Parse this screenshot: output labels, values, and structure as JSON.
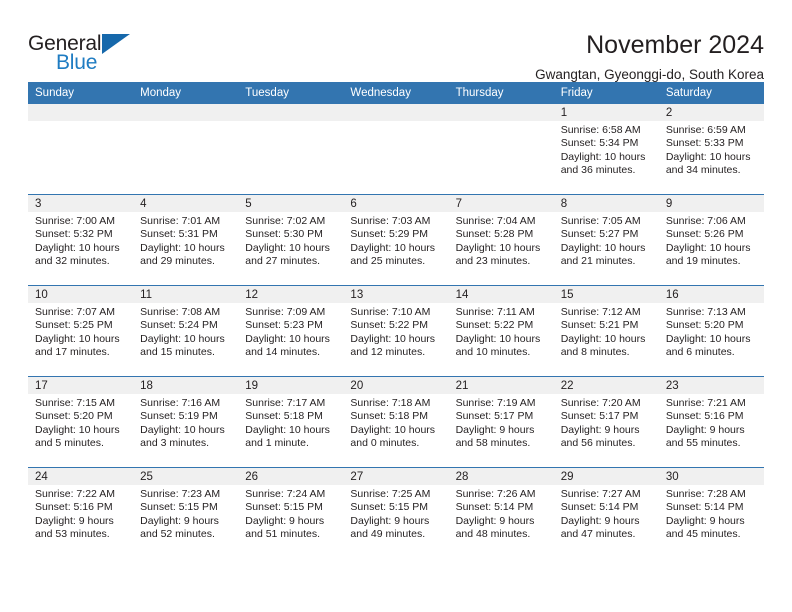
{
  "logo": {
    "word_top": "General",
    "word_bottom": "Blue",
    "triangle_color": "#1668ab",
    "blue_color": "#1f7cc2",
    "icon": "general-blue-logo"
  },
  "header": {
    "title": "November 2024",
    "location": "Gwangtan, Gyeonggi-do, South Korea"
  },
  "theme": {
    "header_blue": "#3375b0",
    "daynum_strip_gray": "#f0f0f0",
    "text": "#231f20"
  },
  "weekday_headers": [
    "Sunday",
    "Monday",
    "Tuesday",
    "Wednesday",
    "Thursday",
    "Friday",
    "Saturday"
  ],
  "weeks": [
    [
      {
        "day": "",
        "empty": true,
        "sunrise": "",
        "sunset": "",
        "daylight_line1": "",
        "daylight_line2": ""
      },
      {
        "day": "",
        "empty": true,
        "sunrise": "",
        "sunset": "",
        "daylight_line1": "",
        "daylight_line2": ""
      },
      {
        "day": "",
        "empty": true,
        "sunrise": "",
        "sunset": "",
        "daylight_line1": "",
        "daylight_line2": ""
      },
      {
        "day": "",
        "empty": true,
        "sunrise": "",
        "sunset": "",
        "daylight_line1": "",
        "daylight_line2": ""
      },
      {
        "day": "",
        "empty": true,
        "sunrise": "",
        "sunset": "",
        "daylight_line1": "",
        "daylight_line2": ""
      },
      {
        "day": "1",
        "empty": false,
        "sunrise": "Sunrise: 6:58 AM",
        "sunset": "Sunset: 5:34 PM",
        "daylight_line1": "Daylight: 10 hours",
        "daylight_line2": "and 36 minutes."
      },
      {
        "day": "2",
        "empty": false,
        "sunrise": "Sunrise: 6:59 AM",
        "sunset": "Sunset: 5:33 PM",
        "daylight_line1": "Daylight: 10 hours",
        "daylight_line2": "and 34 minutes."
      }
    ],
    [
      {
        "day": "3",
        "empty": false,
        "sunrise": "Sunrise: 7:00 AM",
        "sunset": "Sunset: 5:32 PM",
        "daylight_line1": "Daylight: 10 hours",
        "daylight_line2": "and 32 minutes."
      },
      {
        "day": "4",
        "empty": false,
        "sunrise": "Sunrise: 7:01 AM",
        "sunset": "Sunset: 5:31 PM",
        "daylight_line1": "Daylight: 10 hours",
        "daylight_line2": "and 29 minutes."
      },
      {
        "day": "5",
        "empty": false,
        "sunrise": "Sunrise: 7:02 AM",
        "sunset": "Sunset: 5:30 PM",
        "daylight_line1": "Daylight: 10 hours",
        "daylight_line2": "and 27 minutes."
      },
      {
        "day": "6",
        "empty": false,
        "sunrise": "Sunrise: 7:03 AM",
        "sunset": "Sunset: 5:29 PM",
        "daylight_line1": "Daylight: 10 hours",
        "daylight_line2": "and 25 minutes."
      },
      {
        "day": "7",
        "empty": false,
        "sunrise": "Sunrise: 7:04 AM",
        "sunset": "Sunset: 5:28 PM",
        "daylight_line1": "Daylight: 10 hours",
        "daylight_line2": "and 23 minutes."
      },
      {
        "day": "8",
        "empty": false,
        "sunrise": "Sunrise: 7:05 AM",
        "sunset": "Sunset: 5:27 PM",
        "daylight_line1": "Daylight: 10 hours",
        "daylight_line2": "and 21 minutes."
      },
      {
        "day": "9",
        "empty": false,
        "sunrise": "Sunrise: 7:06 AM",
        "sunset": "Sunset: 5:26 PM",
        "daylight_line1": "Daylight: 10 hours",
        "daylight_line2": "and 19 minutes."
      }
    ],
    [
      {
        "day": "10",
        "empty": false,
        "sunrise": "Sunrise: 7:07 AM",
        "sunset": "Sunset: 5:25 PM",
        "daylight_line1": "Daylight: 10 hours",
        "daylight_line2": "and 17 minutes."
      },
      {
        "day": "11",
        "empty": false,
        "sunrise": "Sunrise: 7:08 AM",
        "sunset": "Sunset: 5:24 PM",
        "daylight_line1": "Daylight: 10 hours",
        "daylight_line2": "and 15 minutes."
      },
      {
        "day": "12",
        "empty": false,
        "sunrise": "Sunrise: 7:09 AM",
        "sunset": "Sunset: 5:23 PM",
        "daylight_line1": "Daylight: 10 hours",
        "daylight_line2": "and 14 minutes."
      },
      {
        "day": "13",
        "empty": false,
        "sunrise": "Sunrise: 7:10 AM",
        "sunset": "Sunset: 5:22 PM",
        "daylight_line1": "Daylight: 10 hours",
        "daylight_line2": "and 12 minutes."
      },
      {
        "day": "14",
        "empty": false,
        "sunrise": "Sunrise: 7:11 AM",
        "sunset": "Sunset: 5:22 PM",
        "daylight_line1": "Daylight: 10 hours",
        "daylight_line2": "and 10 minutes."
      },
      {
        "day": "15",
        "empty": false,
        "sunrise": "Sunrise: 7:12 AM",
        "sunset": "Sunset: 5:21 PM",
        "daylight_line1": "Daylight: 10 hours",
        "daylight_line2": "and 8 minutes."
      },
      {
        "day": "16",
        "empty": false,
        "sunrise": "Sunrise: 7:13 AM",
        "sunset": "Sunset: 5:20 PM",
        "daylight_line1": "Daylight: 10 hours",
        "daylight_line2": "and 6 minutes."
      }
    ],
    [
      {
        "day": "17",
        "empty": false,
        "sunrise": "Sunrise: 7:15 AM",
        "sunset": "Sunset: 5:20 PM",
        "daylight_line1": "Daylight: 10 hours",
        "daylight_line2": "and 5 minutes."
      },
      {
        "day": "18",
        "empty": false,
        "sunrise": "Sunrise: 7:16 AM",
        "sunset": "Sunset: 5:19 PM",
        "daylight_line1": "Daylight: 10 hours",
        "daylight_line2": "and 3 minutes."
      },
      {
        "day": "19",
        "empty": false,
        "sunrise": "Sunrise: 7:17 AM",
        "sunset": "Sunset: 5:18 PM",
        "daylight_line1": "Daylight: 10 hours",
        "daylight_line2": "and 1 minute."
      },
      {
        "day": "20",
        "empty": false,
        "sunrise": "Sunrise: 7:18 AM",
        "sunset": "Sunset: 5:18 PM",
        "daylight_line1": "Daylight: 10 hours",
        "daylight_line2": "and 0 minutes."
      },
      {
        "day": "21",
        "empty": false,
        "sunrise": "Sunrise: 7:19 AM",
        "sunset": "Sunset: 5:17 PM",
        "daylight_line1": "Daylight: 9 hours",
        "daylight_line2": "and 58 minutes."
      },
      {
        "day": "22",
        "empty": false,
        "sunrise": "Sunrise: 7:20 AM",
        "sunset": "Sunset: 5:17 PM",
        "daylight_line1": "Daylight: 9 hours",
        "daylight_line2": "and 56 minutes."
      },
      {
        "day": "23",
        "empty": false,
        "sunrise": "Sunrise: 7:21 AM",
        "sunset": "Sunset: 5:16 PM",
        "daylight_line1": "Daylight: 9 hours",
        "daylight_line2": "and 55 minutes."
      }
    ],
    [
      {
        "day": "24",
        "empty": false,
        "sunrise": "Sunrise: 7:22 AM",
        "sunset": "Sunset: 5:16 PM",
        "daylight_line1": "Daylight: 9 hours",
        "daylight_line2": "and 53 minutes."
      },
      {
        "day": "25",
        "empty": false,
        "sunrise": "Sunrise: 7:23 AM",
        "sunset": "Sunset: 5:15 PM",
        "daylight_line1": "Daylight: 9 hours",
        "daylight_line2": "and 52 minutes."
      },
      {
        "day": "26",
        "empty": false,
        "sunrise": "Sunrise: 7:24 AM",
        "sunset": "Sunset: 5:15 PM",
        "daylight_line1": "Daylight: 9 hours",
        "daylight_line2": "and 51 minutes."
      },
      {
        "day": "27",
        "empty": false,
        "sunrise": "Sunrise: 7:25 AM",
        "sunset": "Sunset: 5:15 PM",
        "daylight_line1": "Daylight: 9 hours",
        "daylight_line2": "and 49 minutes."
      },
      {
        "day": "28",
        "empty": false,
        "sunrise": "Sunrise: 7:26 AM",
        "sunset": "Sunset: 5:14 PM",
        "daylight_line1": "Daylight: 9 hours",
        "daylight_line2": "and 48 minutes."
      },
      {
        "day": "29",
        "empty": false,
        "sunrise": "Sunrise: 7:27 AM",
        "sunset": "Sunset: 5:14 PM",
        "daylight_line1": "Daylight: 9 hours",
        "daylight_line2": "and 47 minutes."
      },
      {
        "day": "30",
        "empty": false,
        "sunrise": "Sunrise: 7:28 AM",
        "sunset": "Sunset: 5:14 PM",
        "daylight_line1": "Daylight: 9 hours",
        "daylight_line2": "and 45 minutes."
      }
    ]
  ]
}
